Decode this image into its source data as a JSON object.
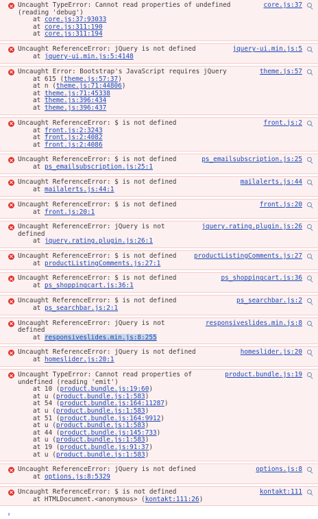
{
  "console": {
    "prompt_symbol": "›",
    "entries": [
      {
        "message": "Uncaught TypeError: Cannot read properties of undefined\n(reading 'debug')",
        "source": "core.js:37",
        "frames": [
          {
            "prefix": "at ",
            "link": "core.js:37:93033",
            "suffix": ""
          },
          {
            "prefix": "at ",
            "link": "core.js:311:190",
            "suffix": ""
          },
          {
            "prefix": "at ",
            "link": "core.js:311:194",
            "suffix": ""
          }
        ]
      },
      {
        "message": "Uncaught ReferenceError: jQuery is not defined",
        "source": "jquery-ui.min.js:5",
        "frames": [
          {
            "prefix": "at ",
            "link": "jquery-ui.min.js:5:4148",
            "suffix": ""
          }
        ]
      },
      {
        "message": "Uncaught Error: Bootstrap's JavaScript requires jQuery",
        "source": "theme.js:57",
        "frames": [
          {
            "prefix": "at 615 (",
            "link": "theme.js:57:37",
            "suffix": ")"
          },
          {
            "prefix": "at n (",
            "link": "theme.js:71:44806",
            "suffix": ")"
          },
          {
            "prefix": "at ",
            "link": "theme.js:71:45338",
            "suffix": ""
          },
          {
            "prefix": "at ",
            "link": "theme.js:396:434",
            "suffix": ""
          },
          {
            "prefix": "at ",
            "link": "theme.js:396:437",
            "suffix": ""
          }
        ]
      },
      {
        "message": "Uncaught ReferenceError: $ is not defined",
        "source": "front.js:2",
        "frames": [
          {
            "prefix": "at ",
            "link": "front.js:2:3243",
            "suffix": ""
          },
          {
            "prefix": "at ",
            "link": "front.js:2:4082",
            "suffix": ""
          },
          {
            "prefix": "at ",
            "link": "front.js:2:4086",
            "suffix": ""
          }
        ]
      },
      {
        "message": "Uncaught ReferenceError: $ is not defined",
        "source": "ps_emailsubscription.js:25",
        "frames": [
          {
            "prefix": "at ",
            "link": "ps_emailsubscription.js:25:1",
            "suffix": ""
          }
        ]
      },
      {
        "message": "Uncaught ReferenceError: $ is not defined",
        "source": "mailalerts.js:44",
        "frames": [
          {
            "prefix": "at ",
            "link": "mailalerts.js:44:1",
            "suffix": ""
          }
        ]
      },
      {
        "message": "Uncaught ReferenceError: $ is not defined",
        "source": "front.js:20",
        "frames": [
          {
            "prefix": "at ",
            "link": "front.js:20:1",
            "suffix": ""
          }
        ]
      },
      {
        "message": "Uncaught ReferenceError: jQuery is not\ndefined",
        "source": "jquery.rating.plugin.js:26",
        "frames": [
          {
            "prefix": "at ",
            "link": "jquery.rating.plugin.js:26:1",
            "suffix": ""
          }
        ]
      },
      {
        "message": "Uncaught ReferenceError: $ is not defined",
        "source": "productListingComments.js:27",
        "frames": [
          {
            "prefix": "at ",
            "link": "productListingComments.js:27:1",
            "suffix": ""
          }
        ]
      },
      {
        "message": "Uncaught ReferenceError: $ is not defined",
        "source": "ps_shoppingcart.js:36",
        "frames": [
          {
            "prefix": "at ",
            "link": "ps_shoppingcart.js:36:1",
            "suffix": ""
          }
        ]
      },
      {
        "message": "Uncaught ReferenceError: $ is not defined",
        "source": "ps_searchbar.js:2",
        "frames": [
          {
            "prefix": "at ",
            "link": "ps_searchbar.js:2:1",
            "suffix": ""
          }
        ]
      },
      {
        "message": "Uncaught ReferenceError: jQuery is not\ndefined",
        "source": "responsiveslides.min.js:8",
        "frames": [
          {
            "prefix": "at ",
            "link": "responsiveslides.min.js:8:255",
            "suffix": "",
            "highlighted": true
          }
        ]
      },
      {
        "message": "Uncaught ReferenceError: jQuery is not defined",
        "source": "homeslider.js:20",
        "frames": [
          {
            "prefix": "at ",
            "link": "homeslider.js:20:1",
            "suffix": ""
          }
        ]
      },
      {
        "message": "Uncaught TypeError: Cannot read properties of\nundefined (reading 'emit')",
        "source": "product.bundle.js:19",
        "frames": [
          {
            "prefix": "at 10 (",
            "link": "product.bundle.js:19:60",
            "suffix": ")"
          },
          {
            "prefix": "at u (",
            "link": "product.bundle.js:1:583",
            "suffix": ")"
          },
          {
            "prefix": "at 54 (",
            "link": "product.bundle.js:164:11287",
            "suffix": ")"
          },
          {
            "prefix": "at u (",
            "link": "product.bundle.js:1:583",
            "suffix": ")"
          },
          {
            "prefix": "at 51 (",
            "link": "product.bundle.js:164:9912",
            "suffix": ")"
          },
          {
            "prefix": "at u (",
            "link": "product.bundle.js:1:583",
            "suffix": ")"
          },
          {
            "prefix": "at 44 (",
            "link": "product.bundle.js:145:733",
            "suffix": ")"
          },
          {
            "prefix": "at u (",
            "link": "product.bundle.js:1:583",
            "suffix": ")"
          },
          {
            "prefix": "at 19 (",
            "link": "product.bundle.js:91:37",
            "suffix": ")"
          },
          {
            "prefix": "at u (",
            "link": "product.bundle.js:1:583",
            "suffix": ")"
          }
        ]
      },
      {
        "message": "Uncaught ReferenceError: jQuery is not defined",
        "source": "options.js:8",
        "frames": [
          {
            "prefix": "at ",
            "link": "options.js:8:5329",
            "suffix": ""
          }
        ]
      },
      {
        "message": "Uncaught ReferenceError: $ is not defined",
        "source": "kontakt:111",
        "frames": [
          {
            "prefix": "at HTMLDocument.<anonymous> (",
            "link": "kontakt:111:26",
            "suffix": ")"
          }
        ]
      }
    ]
  }
}
